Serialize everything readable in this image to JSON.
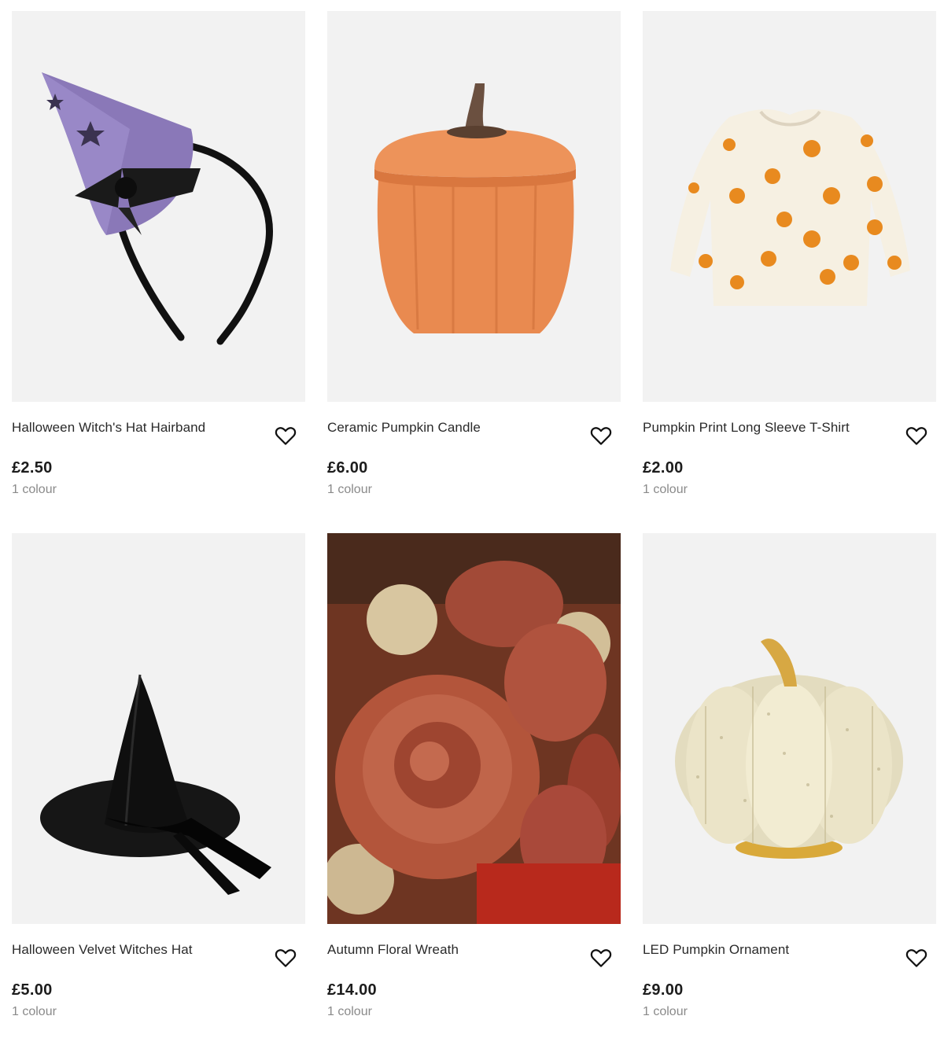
{
  "products": [
    {
      "title": "Halloween Witch's Hat Hairband",
      "price": "£2.50",
      "colours": "1 colour",
      "image_icon": "witch-hat-hairband-image"
    },
    {
      "title": "Ceramic Pumpkin Candle",
      "price": "£6.00",
      "colours": "1 colour",
      "image_icon": "pumpkin-candle-image"
    },
    {
      "title": "Pumpkin Print Long Sleeve T-Shirt",
      "price": "£2.00",
      "colours": "1 colour",
      "image_icon": "pumpkin-tshirt-image"
    },
    {
      "title": "Halloween Velvet Witches Hat",
      "price": "£5.00",
      "colours": "1 colour",
      "image_icon": "witch-hat-image"
    },
    {
      "title": "Autumn Floral Wreath",
      "price": "£14.00",
      "colours": "1 colour",
      "image_icon": "floral-wreath-image"
    },
    {
      "title": "LED Pumpkin Ornament",
      "price": "£9.00",
      "colours": "1 colour",
      "image_icon": "led-pumpkin-image"
    }
  ],
  "icons": {
    "wishlist": "heart-icon"
  },
  "colors": {
    "image_bg": "#f2f2f2",
    "text": "#2a2a2a",
    "muted": "#8a8a8a"
  }
}
